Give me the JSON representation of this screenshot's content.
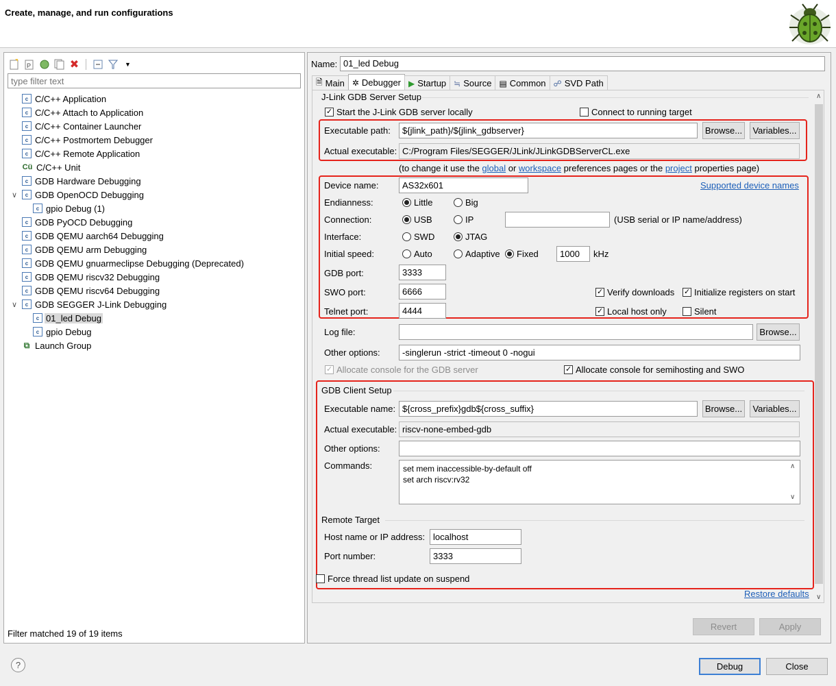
{
  "dialog": {
    "title": "Create, manage, and run configurations"
  },
  "left": {
    "filter_placeholder": "type filter text",
    "tree": [
      {
        "label": "C/C++ Application",
        "icon": "c-config-icon"
      },
      {
        "label": "C/C++ Attach to Application",
        "icon": "c-config-icon"
      },
      {
        "label": "C/C++ Container Launcher",
        "icon": "c-config-icon"
      },
      {
        "label": "C/C++ Postmortem Debugger",
        "icon": "c-config-icon"
      },
      {
        "label": "C/C++ Remote Application",
        "icon": "c-config-icon"
      },
      {
        "label": "C/C++ Unit",
        "icon": "c-unit-icon"
      },
      {
        "label": "GDB Hardware Debugging",
        "icon": "c-config-icon"
      },
      {
        "label": "GDB OpenOCD Debugging",
        "icon": "c-config-icon"
      },
      {
        "label": "gpio Debug (1)",
        "icon": "c-config-icon"
      },
      {
        "label": "GDB PyOCD Debugging",
        "icon": "c-config-icon"
      },
      {
        "label": "GDB QEMU aarch64 Debugging",
        "icon": "c-config-icon"
      },
      {
        "label": "GDB QEMU arm Debugging",
        "icon": "c-config-icon"
      },
      {
        "label": "GDB QEMU gnuarmeclipse Debugging (Deprecated)",
        "icon": "c-config-icon"
      },
      {
        "label": "GDB QEMU riscv32 Debugging",
        "icon": "c-config-icon"
      },
      {
        "label": "GDB QEMU riscv64 Debugging",
        "icon": "c-config-icon"
      },
      {
        "label": "GDB SEGGER J-Link Debugging",
        "icon": "c-config-icon"
      },
      {
        "label": "01_led Debug",
        "icon": "c-config-icon"
      },
      {
        "label": "gpio Debug",
        "icon": "c-config-icon"
      },
      {
        "label": "Launch Group",
        "icon": "launch-group-icon"
      }
    ],
    "filter_status": "Filter matched 19 of 19 items"
  },
  "right": {
    "name_label": "Name:",
    "name_value": "01_led Debug",
    "tabs": [
      {
        "label": "Main",
        "icon": "document-icon"
      },
      {
        "label": "Debugger",
        "icon": "bug-icon"
      },
      {
        "label": "Startup",
        "icon": "play-icon"
      },
      {
        "label": "Source",
        "icon": "source-icon"
      },
      {
        "label": "Common",
        "icon": "common-icon"
      },
      {
        "label": "SVD Path",
        "icon": "svd-icon"
      }
    ],
    "server": {
      "group": "J-Link GDB Server Setup",
      "start_locally": "Start the J-Link GDB server locally",
      "connect_running": "Connect to running target",
      "exec_path_label": "Executable path:",
      "exec_path_value": "${jlink_path}/${jlink_gdbserver}",
      "browse": "Browse...",
      "variables": "Variables...",
      "actual_label": "Actual executable:",
      "actual_value": "C:/Program Files/SEGGER/JLink/JLinkGDBServerCL.exe",
      "hint_prefix": "(to change it use the ",
      "hint_global": "global",
      "hint_or": " or ",
      "hint_workspace": "workspace",
      "hint_mid": " preferences pages or the ",
      "hint_project": "project",
      "hint_suffix": " properties page)",
      "device_label": "Device name:",
      "device_value": "AS32x601",
      "supported_link": "Supported device names",
      "endianness_label": "Endianness:",
      "little": "Little",
      "big": "Big",
      "connection_label": "Connection:",
      "usb": "USB",
      "ip": "IP",
      "usb_ip_value": "",
      "usb_ip_hint": "(USB serial or IP name/address)",
      "interface_label": "Interface:",
      "swd": "SWD",
      "jtag": "JTAG",
      "speed_label": "Initial speed:",
      "auto": "Auto",
      "adaptive": "Adaptive",
      "fixed": "Fixed",
      "speed_value": "1000",
      "khz": "kHz",
      "gdb_port_label": "GDB port:",
      "gdb_port_value": "3333",
      "swo_port_label": "SWO port:",
      "swo_port_value": "6666",
      "verify_downloads": "Verify downloads",
      "init_registers": "Initialize registers on start",
      "telnet_label": "Telnet port:",
      "telnet_value": "4444",
      "local_host_only": "Local host only",
      "silent": "Silent",
      "log_label": "Log file:",
      "log_value": "",
      "other_label": "Other options:",
      "other_value": "-singlerun -strict -timeout 0 -nogui",
      "alloc_gdb": "Allocate console for the GDB server",
      "alloc_semi": "Allocate console for semihosting and SWO"
    },
    "client": {
      "group": "GDB Client Setup",
      "exec_name_label": "Executable name:",
      "exec_name_value": "${cross_prefix}gdb${cross_suffix}",
      "actual_label": "Actual executable:",
      "actual_value": "riscv-none-embed-gdb",
      "other_label": "Other options:",
      "other_value": "",
      "commands_label": "Commands:",
      "commands_value": "set mem inaccessible-by-default off\nset arch riscv:rv32"
    },
    "remote": {
      "group": "Remote Target",
      "host_label": "Host name or IP address:",
      "host_value": "localhost",
      "port_label": "Port number:",
      "port_value": "3333"
    },
    "force_thread": "Force thread list update on suspend",
    "restore_defaults": "Restore defaults",
    "revert": "Revert",
    "apply": "Apply"
  },
  "footer": {
    "debug": "Debug",
    "close": "Close"
  }
}
